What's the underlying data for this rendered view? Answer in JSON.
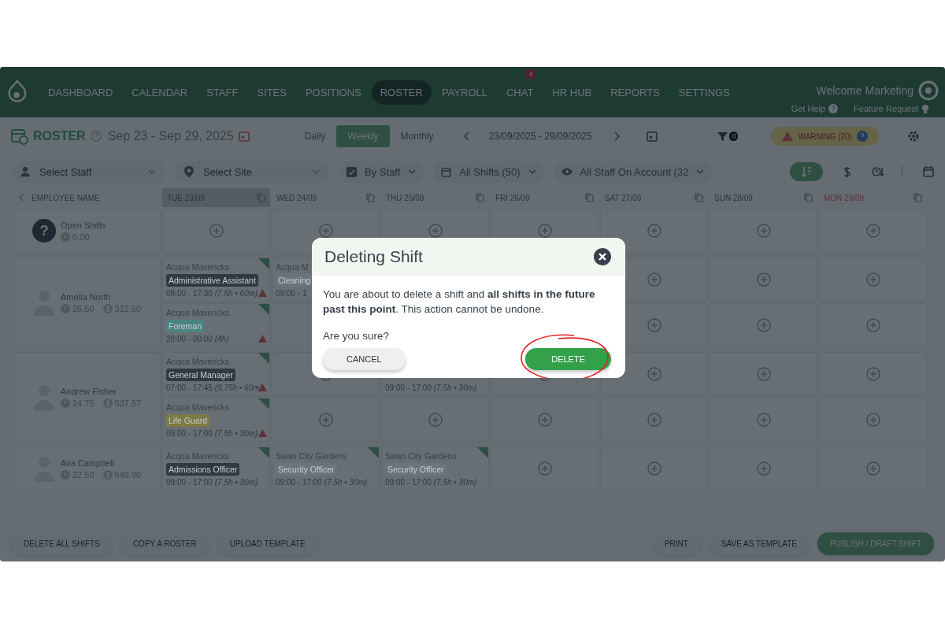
{
  "nav": {
    "items": [
      {
        "label": "DASHBOARD",
        "selected": false
      },
      {
        "label": "CALENDAR",
        "selected": false
      },
      {
        "label": "STAFF",
        "selected": false
      },
      {
        "label": "SITES",
        "selected": false
      },
      {
        "label": "POSITIONS",
        "selected": false
      },
      {
        "label": "ROSTER",
        "selected": true
      },
      {
        "label": "PAYROLL",
        "selected": false
      },
      {
        "label": "CHAT",
        "selected": false,
        "badge": "4"
      },
      {
        "label": "HR HUB",
        "selected": false
      },
      {
        "label": "REPORTS",
        "selected": false
      },
      {
        "label": "SETTINGS",
        "selected": false
      }
    ],
    "welcome": "Welcome Marketing",
    "get_help": "Get Help",
    "feature_request": "Feature Request"
  },
  "toolbar": {
    "title": "ROSTER",
    "date_range": "Sep 23 - Sep 29, 2025",
    "views": [
      {
        "label": "Daily",
        "selected": false
      },
      {
        "label": "Weekly",
        "selected": true
      },
      {
        "label": "Monthly",
        "selected": false
      }
    ],
    "range": "23/09/2025 - 29/09/2025",
    "filter_count": "0",
    "warning": "WARNING (20)"
  },
  "filters": {
    "staff": {
      "placeholder": "Select Staff"
    },
    "site": {
      "placeholder": "Select Site"
    },
    "group_by": "By Staff",
    "shifts": "All Shifts (50)",
    "account": "All Staff On Account (32"
  },
  "grid": {
    "first_column": "EMPLOYEE NAME",
    "days": [
      {
        "label": "TUE 23/09",
        "highlighted": true,
        "alert": false
      },
      {
        "label": "WED 24/09",
        "highlighted": false,
        "alert": false
      },
      {
        "label": "THU 25/09",
        "highlighted": false,
        "alert": false
      },
      {
        "label": "FRI 26/09",
        "highlighted": false,
        "alert": false
      },
      {
        "label": "SAT 27/09",
        "highlighted": false,
        "alert": false
      },
      {
        "label": "SUN 28/09",
        "highlighted": false,
        "alert": false
      },
      {
        "label": "MON 29/09",
        "highlighted": false,
        "alert": true
      }
    ],
    "rows": [
      {
        "kind": "open",
        "icon": "?",
        "name": "Open Shifts",
        "hours": "0.00",
        "cells": [
          [
            null
          ],
          [
            null
          ],
          [
            null
          ],
          [
            null
          ],
          [
            null
          ],
          [
            null
          ],
          [
            null
          ]
        ]
      },
      {
        "kind": "employee",
        "name": "Amelia North",
        "hours": "26.50",
        "pay": "312.50",
        "cells": [
          [
            {
              "site": "Acqua Mavericks",
              "role": "Administrative Assistant",
              "color": "#2f3a44",
              "time": "09:00 - 17:30",
              "duration": "(7.5h • 60m)",
              "warning": true
            },
            {
              "site": "Acqua Mavericks",
              "role": "Foreman",
              "color": "#4a8582",
              "time": "20:00 - 00:00",
              "duration": "(4h)",
              "warning": true
            }
          ],
          [
            {
              "site": "Acqua M",
              "role": "Cleaning",
              "color": "#6b737b",
              "time": "09:00 - 1"
            },
            null
          ],
          [
            null,
            null
          ],
          [
            null,
            null
          ],
          [
            null,
            null
          ],
          [
            null,
            null
          ],
          [
            null,
            null
          ]
        ]
      },
      {
        "kind": "employee",
        "name": "Andrew Fisher",
        "hours": "24.75",
        "pay": "537.57",
        "cells": [
          [
            {
              "site": "Acqua Mavericks",
              "role": "General Manager",
              "color": "#2f3a44",
              "time": "07:00 - 17:45",
              "duration": "(9.75h • 60m)",
              "warning": true
            },
            {
              "site": "Acqua Mavericks",
              "role": "Life Guard",
              "color": "#7c7a45",
              "time": "09:00 - 17:00",
              "duration": "(7.5h • 30m)",
              "warning": true
            }
          ],
          [
            null,
            null
          ],
          [
            {
              "time": "09:00 - 17:00",
              "duration": "(7.5h • 30m)",
              "warning": false
            },
            null
          ],
          [
            null,
            null
          ],
          [
            null,
            null
          ],
          [
            null,
            null
          ],
          [
            null,
            null
          ]
        ]
      },
      {
        "kind": "employee",
        "name": "Ava Campbell",
        "hours": "22.50",
        "pay": "549.90",
        "cells": [
          [
            {
              "site": "Acqua Mavericks",
              "role": "Admissions Officer",
              "color": "#2f3a44",
              "time": "09:00 - 17:00",
              "duration": "(7.5h • 30m)",
              "warning": false
            }
          ],
          [
            {
              "site": "Swan City Gardens",
              "role": "Security Officer",
              "color": "#6b737b",
              "time": "09:00 - 17:00",
              "duration": "(7.5h • 30m)",
              "warning": false
            }
          ],
          [
            {
              "site": "Swan City Gardens",
              "role": "Security Officer",
              "color": "#6b737b",
              "time": "09:00 - 17:00",
              "duration": "(7.5h • 30m)",
              "warning": false
            }
          ],
          [
            null
          ],
          [
            null
          ],
          [
            null
          ],
          [
            null
          ]
        ]
      }
    ]
  },
  "footer": {
    "left": [
      {
        "label": "DELETE ALL SHIFTS",
        "kind": "plain"
      },
      {
        "label": "COPY A ROSTER",
        "kind": "plain"
      },
      {
        "label": "UPLOAD TEMPLATE",
        "kind": "plain"
      }
    ],
    "right": [
      {
        "label": "PRINT",
        "kind": "plain"
      },
      {
        "label": "SAVE AS TEMPLATE",
        "kind": "plain"
      },
      {
        "label": "PUBLISH / DRAFT SHIFT",
        "kind": "primary"
      }
    ]
  },
  "dialog": {
    "title": "Deleting Shift",
    "message": "You are about to delete a shift and **all shifts in the future past this point**. This action cannot be undone.",
    "question": "Are you sure?",
    "cancel": {
      "label": "CANCEL"
    },
    "confirm": {
      "label": "DELETE",
      "highlighted": true
    }
  }
}
